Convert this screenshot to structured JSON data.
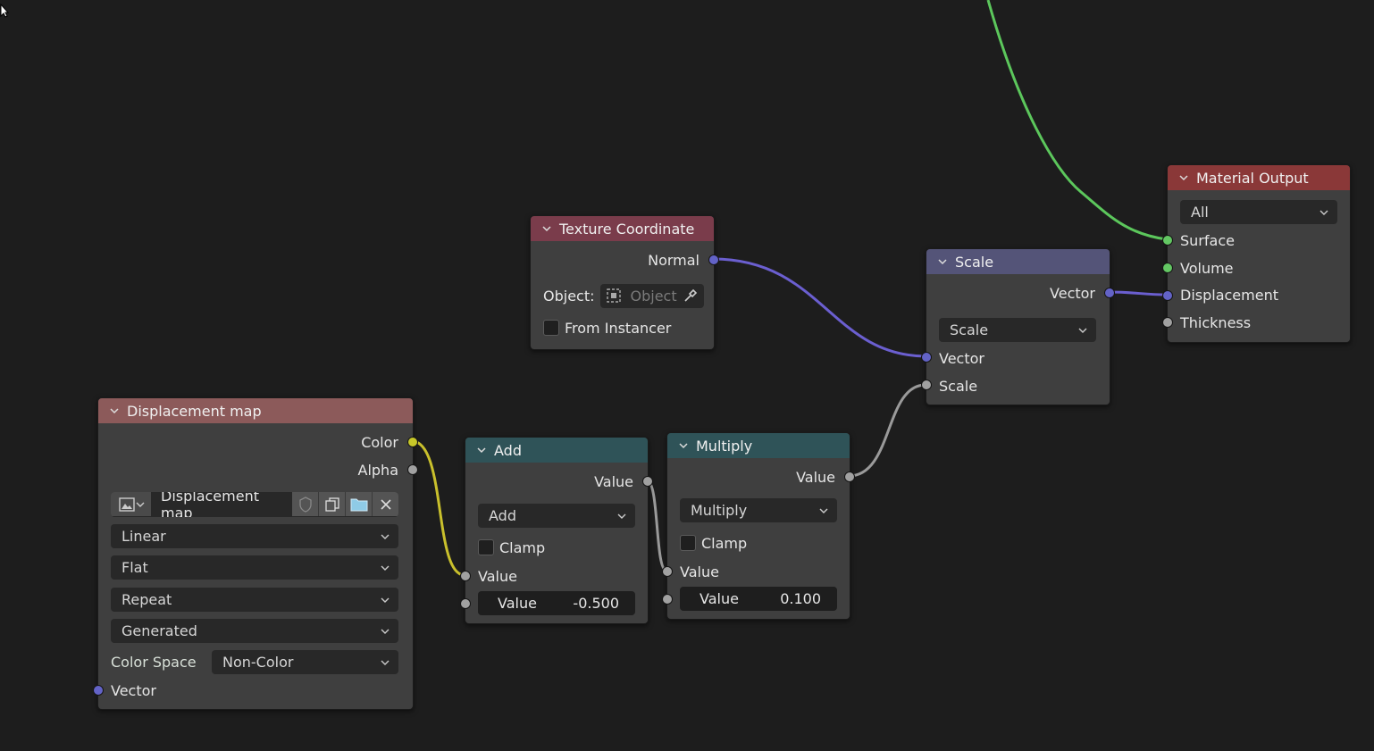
{
  "nodes": {
    "material_output": {
      "title": "Material Output",
      "target": "All",
      "inputs": [
        "Surface",
        "Volume",
        "Displacement",
        "Thickness"
      ]
    },
    "texture_coordinate": {
      "title": "Texture Coordinate",
      "output": "Normal",
      "object_label": "Object:",
      "object_placeholder": "Object",
      "from_instancer": "From Instancer"
    },
    "scale": {
      "title": "Scale",
      "output": "Vector",
      "operation": "Scale",
      "inputs": [
        "Vector",
        "Scale"
      ]
    },
    "displacement_map": {
      "title": "Displacement map",
      "outputs": [
        "Color",
        "Alpha"
      ],
      "image_name": "Displacement map",
      "interpolation": "Linear",
      "projection": "Flat",
      "extension": "Repeat",
      "source": "Generated",
      "color_space_label": "Color Space",
      "color_space": "Non-Color",
      "input": "Vector"
    },
    "add": {
      "title": "Add",
      "output": "Value",
      "operation": "Add",
      "clamp": "Clamp",
      "input_value": "Value",
      "field_label": "Value",
      "field_value": "-0.500"
    },
    "multiply": {
      "title": "Multiply",
      "output": "Value",
      "operation": "Multiply",
      "clamp": "Clamp",
      "input_value": "Value",
      "field_label": "Value",
      "field_value": "0.100"
    }
  },
  "colors": {
    "background": "#1d1d1d",
    "socket_float": "#a1a1a1",
    "socket_vector": "#6363c7",
    "socket_shader": "#63c763",
    "socket_color": "#c7c729",
    "wire_vector": "#6b5fd0",
    "wire_shader": "#5cc75c",
    "wire_float": "#9a9a9a",
    "wire_color": "#c9c02c"
  }
}
